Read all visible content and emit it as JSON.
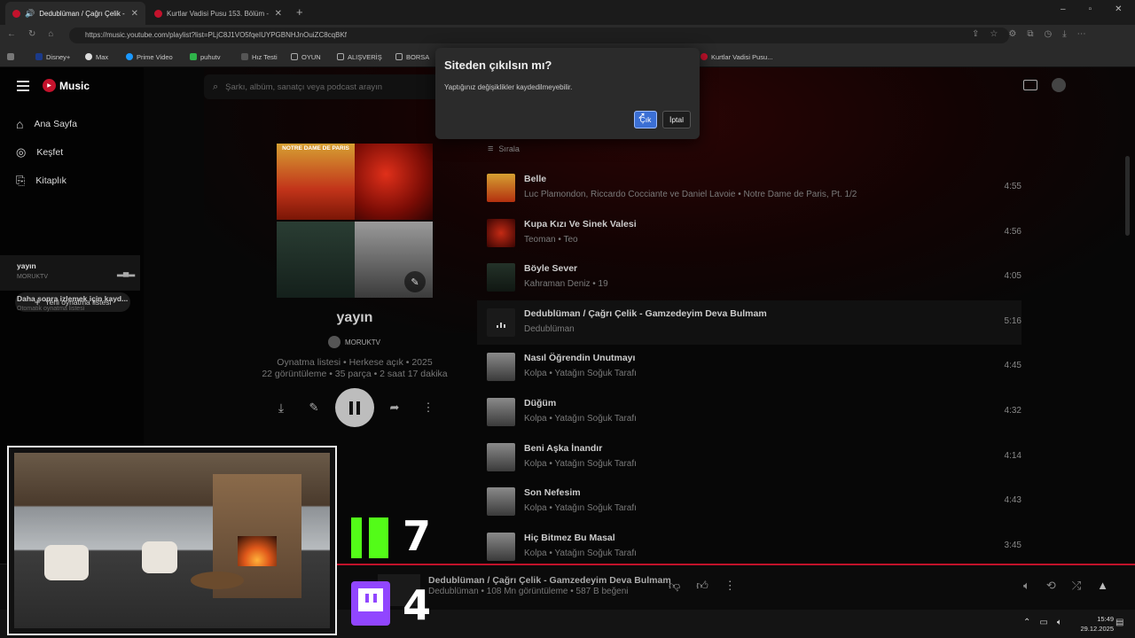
{
  "browser": {
    "tabs": [
      {
        "title": "Dedublüman / Çağrı Çelik - G",
        "active": true
      },
      {
        "title": "Kurtlar Vadisi Pusu 153. Bölüm - Y",
        "active": false
      }
    ],
    "url": "https://music.youtube.com/playlist?list=PLjC8J1VO5fqeIUYPGBNHJnOuiZC8cqBKf",
    "bookmarks": [
      "Disney+",
      "Max",
      "Prime Video",
      "puhutv",
      "Hız Testi",
      "OYUN",
      "ALIŞVERİŞ",
      "BORSA",
      "Kurtlar Vadisi Pusu..."
    ]
  },
  "app": {
    "logo": "Music",
    "search_placeholder": "Şarkı, albüm, sanatçı veya podcast arayın",
    "nav": [
      "Ana Sayfa",
      "Keşfet",
      "Kitaplık"
    ],
    "new_playlist": "Yeni oynatma listesi",
    "library": [
      {
        "title": "yayın",
        "sub": "MORUKTV"
      },
      {
        "title": "Daha sonra izlemek için kayd...",
        "sub": "Otomatik oynatma listesi"
      }
    ]
  },
  "playlist": {
    "title": "yayın",
    "owner": "MORUKTV",
    "meta1": "Oynatma listesi • Herkese açık • 2025",
    "meta2": "22 görüntüleme • 35 parça • 2 saat 17 dakika",
    "cover_text": "NOTRE DAME DE PARIS",
    "sort_label": "Sırala"
  },
  "tracks": [
    {
      "title": "Belle",
      "subtitle": "Luc Plamondon, Riccardo Cocciante ve Daniel Lavoie • Notre Dame de Paris, Pt. 1/2",
      "duration": "4:55"
    },
    {
      "title": "Kupa Kızı Ve Sinek Valesi",
      "subtitle": "Teoman • Teo",
      "duration": "4:56"
    },
    {
      "title": "Böyle Sever",
      "subtitle": "Kahraman Deniz • 19",
      "duration": "4:05"
    },
    {
      "title": "Dedublüman / Çağrı Çelik - Gamzedeyim Deva Bulmam",
      "subtitle": "Dedublüman",
      "duration": "5:16"
    },
    {
      "title": "Nasıl Öğrendin Unutmayı",
      "subtitle": "Kolpa • Yatağın Soğuk Tarafı",
      "duration": "4:45"
    },
    {
      "title": "Düğüm",
      "subtitle": "Kolpa • Yatağın Soğuk Tarafı",
      "duration": "4:32"
    },
    {
      "title": "Beni Aşka İnandır",
      "subtitle": "Kolpa • Yatağın Soğuk Tarafı",
      "duration": "4:14"
    },
    {
      "title": "Son Nefesim",
      "subtitle": "Kolpa • Yatağın Soğuk Tarafı",
      "duration": "4:43"
    },
    {
      "title": "Hiç Bitmez Bu Masal",
      "subtitle": "Kolpa • Yatağın Soğuk Tarafı",
      "duration": "3:45"
    }
  ],
  "player": {
    "title": "Dedublüman / Çağrı Çelik - Gamzedeyim Deva Bulmam",
    "subtitle": "Dedublüman • 108 Mn görüntüleme • 587 B beğeni"
  },
  "dialog": {
    "title": "Siteden çıkılsın mı?",
    "message": "Yaptığınız değişiklikler kaydedilmeyebilir.",
    "confirm": "Çık",
    "cancel": "İptal"
  },
  "overlay": {
    "kick_count": "7",
    "twitch_count": "4"
  },
  "taskbar": {
    "time": "15:49",
    "date": "29.12.2025"
  },
  "colors": {
    "accent": "#c4122c",
    "kick": "#53fc18",
    "twitch": "#9146ff",
    "dialog_primary": "#3b6fd4"
  }
}
